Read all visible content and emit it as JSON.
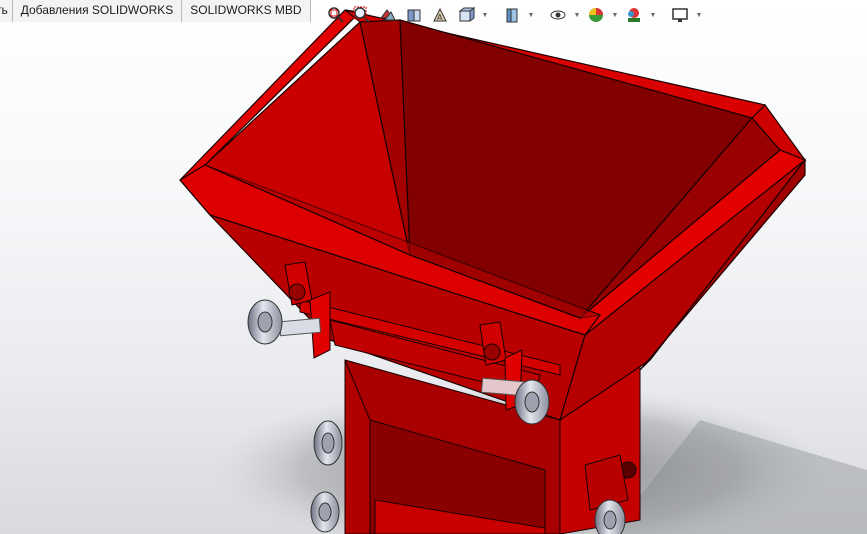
{
  "tabs": [
    {
      "label": "ть",
      "id": "tab-truncated"
    },
    {
      "label": "Добавления SOLIDWORKS",
      "id": "tab-solidworks-addins"
    },
    {
      "label": "SOLIDWORKS MBD",
      "id": "tab-solidworks-mbd"
    }
  ],
  "heads_up_toolbar": {
    "icons": [
      "zoom-to-fit-icon",
      "zoom-to-area-icon",
      "previous-view-icon",
      "section-view-icon",
      "dynamic-annotation-icon",
      "view-orientation-icon",
      "display-style-icon",
      "hide-show-items-icon",
      "edit-appearance-icon",
      "apply-scene-icon",
      "view-settings-icon"
    ]
  },
  "colors": {
    "part_red": "#c00000",
    "part_dark_red": "#7a0000",
    "part_edge": "#1a0000",
    "wheel_gray": "#b9bdc8",
    "background_top": "#ffffff",
    "background_bottom": "#d8dadd"
  }
}
